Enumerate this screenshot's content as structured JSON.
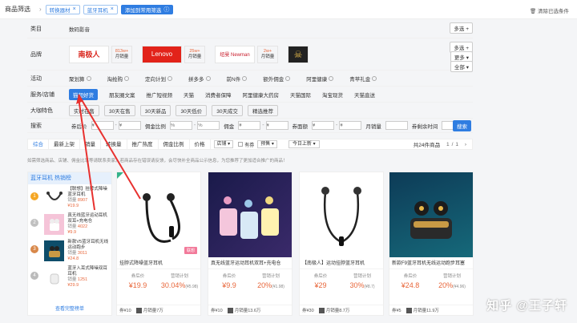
{
  "breadcrumb": {
    "label": "商品筛选",
    "tags": [
      "转换器材",
      "蓝牙耳机"
    ],
    "current": "添加到常用筛选",
    "clear_all": "清除已选条件"
  },
  "filters": {
    "category_label": "类目",
    "category_value": "数码影音",
    "more_multi": "多选",
    "more": "更多",
    "all": "全部",
    "brand_label": "品牌",
    "brands": [
      {
        "logo": "南极人",
        "count": "813w+",
        "unit": "月销量",
        "color": "#d9251c"
      },
      {
        "logo": "Lenovo",
        "count": "25w+",
        "unit": "月销量",
        "color": "#e2231a"
      },
      {
        "logo": "纽曼 Newman",
        "count": "2w+",
        "unit": "月销量",
        "color": "#c81c2b"
      },
      {
        "logo": "☠",
        "count": "",
        "unit": "",
        "color": "#222"
      }
    ],
    "activity_label": "活动",
    "activities": [
      "聚划算",
      "淘抢购",
      "定向计划",
      "拼多多",
      "前N件",
      "额外佣金",
      "阿里健康",
      "青苹礼金"
    ],
    "service_label": "服务/店铺",
    "services": [
      "猫超好货",
      "朋友圈文案",
      "推广短视频",
      "天猫",
      "消费者保障",
      "阿里健康大药房",
      "天猫国际",
      "淘宝现货",
      "天猫直送"
    ],
    "tag_label": "大咖特色",
    "tags": [
      "实时在售",
      "30天在售",
      "30天新品",
      "30天低价",
      "30天成交",
      "精选推荐"
    ],
    "search_label": "搜索",
    "search_fields": [
      {
        "label": "券后价",
        "dash": "-",
        "unit": "¥"
      },
      {
        "label": "佣金比例",
        "dash": "-",
        "unit": "%"
      },
      {
        "label": "佣金",
        "dash": "-",
        "unit": "¥"
      },
      {
        "label": "券面额",
        "dash": "-",
        "unit": "¥"
      },
      {
        "label": "月销量",
        "dash": "-",
        "unit": ""
      },
      {
        "label": "券剩余时间",
        "dash": "-",
        "unit": ""
      }
    ],
    "search_button": "搜索"
  },
  "sortbar": {
    "items": [
      "综合",
      "最新上架",
      "销量",
      "转换量",
      "推广热度",
      "佣金比例",
      "价格"
    ],
    "active_index": 0,
    "store_select": "店铺",
    "coupon_check": "有券",
    "coupon_select": "预售",
    "today": "今日上新",
    "total": "共24件商品",
    "page": "1/1"
  },
  "hint": "如需筛选商品、店铺、佣金比率等请联系卖家。若商品存在错误请反馈，会尽快补全商品公示信息，为您推荐了更加适合推广的商品！",
  "rank": {
    "title": "蓝牙耳机 热销榜",
    "items": [
      {
        "num": "1",
        "color": "#f5a623",
        "name": "【联想】挂脖式降噪蓝牙耳机",
        "sales_label": "销量",
        "sales": "8907",
        "price": "¥19.9"
      },
      {
        "num": "2",
        "color": "#c0c0c0",
        "name": "真无线蓝牙运动耳机双耳+充电仓",
        "sales_label": "销量",
        "sales": "4022",
        "price": "¥9.9"
      },
      {
        "num": "3",
        "color": "#d8884a",
        "name": "新款V5蓝牙耳机无线运动跑步",
        "sales_label": "销量",
        "sales": "3011",
        "price": "¥24.8"
      },
      {
        "num": "4",
        "color": "#bbbbbb",
        "name": "蓝牙入耳式降噪双耳耳机",
        "sales_label": "销量",
        "sales": "1251",
        "price": "¥29.9"
      }
    ],
    "footer": "查看完整榜单"
  },
  "cards": [
    {
      "name": "挂脖式降噪蓝牙耳机",
      "badge": "联想",
      "price_label": "券后价",
      "price": "¥19.9",
      "rate_label": "营销计划",
      "rate": "30.04%",
      "rate_sub": "(¥5.98)",
      "coupon": "券¥10",
      "sales": "月销量7万"
    },
    {
      "name": "真无线蓝牙运动耳机双耳+充电仓",
      "badge": "",
      "price_label": "券后价",
      "price": "¥9.9",
      "rate_label": "营销计划",
      "rate": "20%",
      "rate_sub": "(¥1.98)",
      "coupon": "券¥10",
      "sales": "月销量13.6万"
    },
    {
      "name": "【南极人】运动挂脖蓝牙耳机",
      "badge": "",
      "price_label": "券后价",
      "price": "¥29",
      "rate_label": "营销计划",
      "rate": "30%",
      "rate_sub": "(¥8.7)",
      "coupon": "券¥30",
      "sales": "月销量8.7万"
    },
    {
      "name": "新款F9蓝牙耳机无线运动跑步耳塞",
      "badge": "",
      "price_label": "券后价",
      "price": "¥24.8",
      "rate_label": "营销计划",
      "rate": "20%",
      "rate_sub": "(¥4.96)",
      "coupon": "券¥5",
      "sales": "月销量11.9万"
    }
  ],
  "watermark": "知乎 @王子轩"
}
